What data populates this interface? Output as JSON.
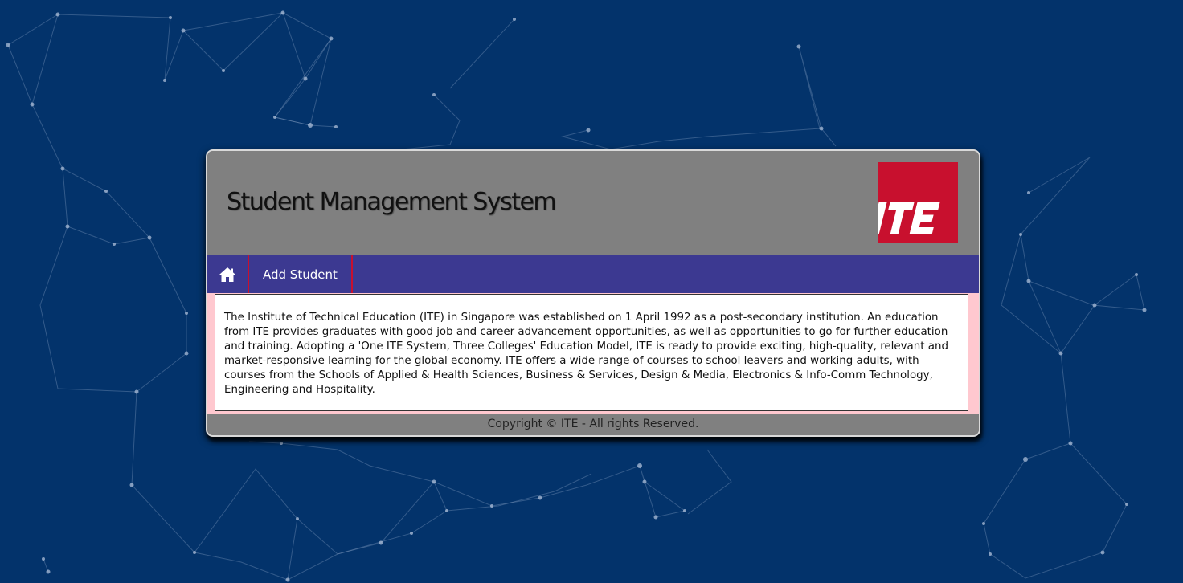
{
  "header": {
    "title": "Student Management System",
    "logo_text": "ITE"
  },
  "nav": {
    "home_icon": "home-icon",
    "items": [
      {
        "label": "Add Student"
      }
    ]
  },
  "main": {
    "paragraph": "The Institute of Technical Education (ITE) in Singapore was established on 1 April 1992 as a post-secondary institution. An education from ITE provides graduates with good job and career advancement opportunities, as well as opportunities to go for further education and training. Adopting a 'One ITE System, Three Colleges' Education Model, ITE is ready to provide exciting, high-quality, relevant and market-responsive learning for the global economy. ITE offers a wide range of courses to school leavers and working adults, with courses from the Schools of Applied & Health Sciences, Business & Services, Design & Media, Electronics & Info-Comm Technology, Engineering and Hospitality."
  },
  "footer": {
    "copyright": "Copyright © ITE - All rights Reserved."
  },
  "colors": {
    "page_background": "#03336b",
    "header_background": "#808080",
    "nav_background": "#3c3991",
    "nav_divider": "#c8102e",
    "logo_red": "#c8102e",
    "content_border_pink": "#ffc8cf"
  }
}
